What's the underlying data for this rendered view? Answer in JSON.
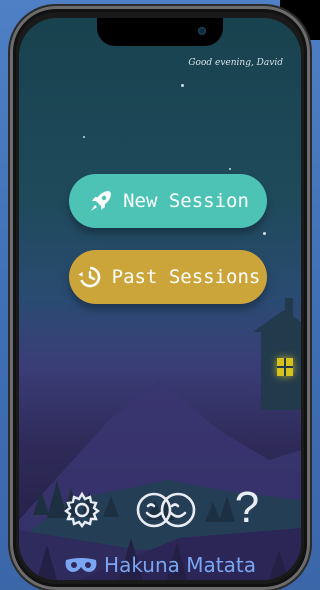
{
  "greeting": "Good evening, David",
  "buttons": {
    "new_session": "New Session",
    "past_sessions": "Past Sessions"
  },
  "icons": {
    "new_session": "rocket-icon",
    "past_sessions": "history-icon",
    "settings": "gear-icon",
    "profiles": "faces-icon",
    "help": "question-icon",
    "brand": "mask-icon"
  },
  "help_glyph": "?",
  "brand_name": "Hakuna Matata",
  "colors": {
    "new_session_button": "#4cc3b4",
    "past_sessions_button": "#cca53a",
    "brand_text": "#7aa6f4",
    "window_light": "#d6c21c"
  }
}
